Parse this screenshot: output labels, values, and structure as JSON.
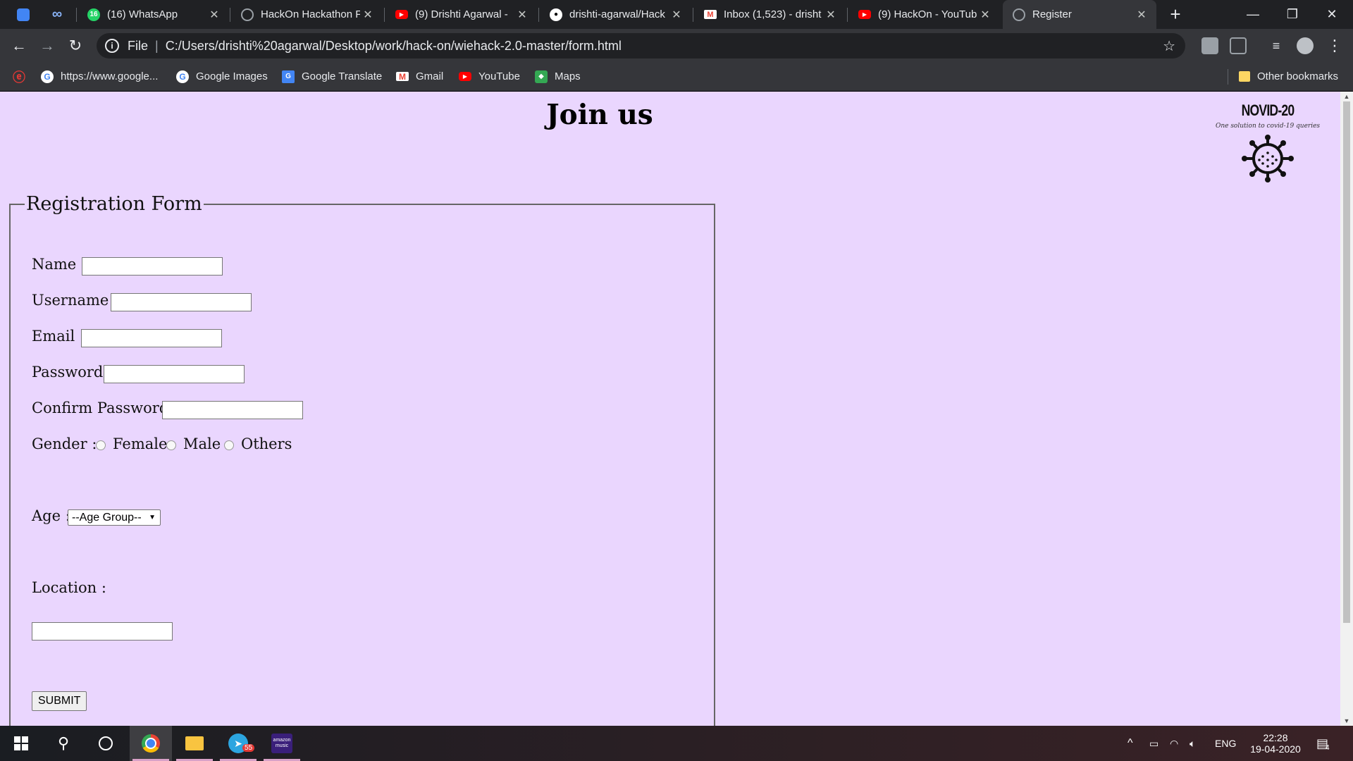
{
  "browser": {
    "tabs": [
      {
        "title": "",
        "icon": "app-icon",
        "color": "#4285f4"
      },
      {
        "title": "",
        "icon": "infinity-icon",
        "color": "#8ab4f8"
      },
      {
        "title": "(16) WhatsApp",
        "icon": "whatsapp-icon",
        "badge": "16",
        "color": "#25d366"
      },
      {
        "title": "HackOn Hackathon F",
        "icon": "globe-icon",
        "color": "#9aa0a6"
      },
      {
        "title": "(9) Drishti Agarwal -",
        "icon": "youtube-icon",
        "color": "#ff0000"
      },
      {
        "title": "drishti-agarwal/Hack",
        "icon": "github-icon",
        "color": "#ffffff"
      },
      {
        "title": "Inbox (1,523) - drisht",
        "icon": "gmail-icon",
        "color": "#ea4335"
      },
      {
        "title": "(9) HackOn - YouTub",
        "icon": "youtube-icon",
        "color": "#ff0000"
      },
      {
        "title": "Register",
        "icon": "globe-icon",
        "color": "#9aa0a6",
        "active": true
      }
    ],
    "new_tab": "+",
    "address": {
      "scheme": "File",
      "url": "C:/Users/drishti%20agarwal/Desktop/work/hack-on/wiehack-2.0-master/form.html"
    },
    "bookmarks": [
      {
        "label": "",
        "icon": "airtel-icon"
      },
      {
        "label": "https://www.google...",
        "icon": "google-icon"
      },
      {
        "label": "Google Images",
        "icon": "google-icon"
      },
      {
        "label": "Google Translate",
        "icon": "translate-icon"
      },
      {
        "label": "Gmail",
        "icon": "gmail-icon"
      },
      {
        "label": "YouTube",
        "icon": "youtube-icon"
      },
      {
        "label": "Maps",
        "icon": "maps-icon"
      }
    ],
    "other_bookmarks": "Other bookmarks"
  },
  "page": {
    "title": "Join us",
    "logo": {
      "brand": "NOVID-20",
      "tagline": "One solution to covid-19 queries"
    },
    "form": {
      "legend": "Registration Form",
      "name_label": "Name :",
      "username_label": "Username :",
      "email_label": "Email :",
      "password_label": "Password :",
      "confirm_label": "Confirm Password :",
      "gender_label": "Gender :",
      "gender_options": [
        "Female",
        "Male",
        "Others"
      ],
      "age_label": "Age :",
      "age_selected": "--Age Group--",
      "location_label": "Location :",
      "submit_label": "SUBMIT"
    }
  },
  "taskbar": {
    "telegram_badge": "55",
    "music_label": "amazon music",
    "language": "ENG",
    "time": "22:28",
    "date": "19-04-2020",
    "notifications": "4"
  }
}
